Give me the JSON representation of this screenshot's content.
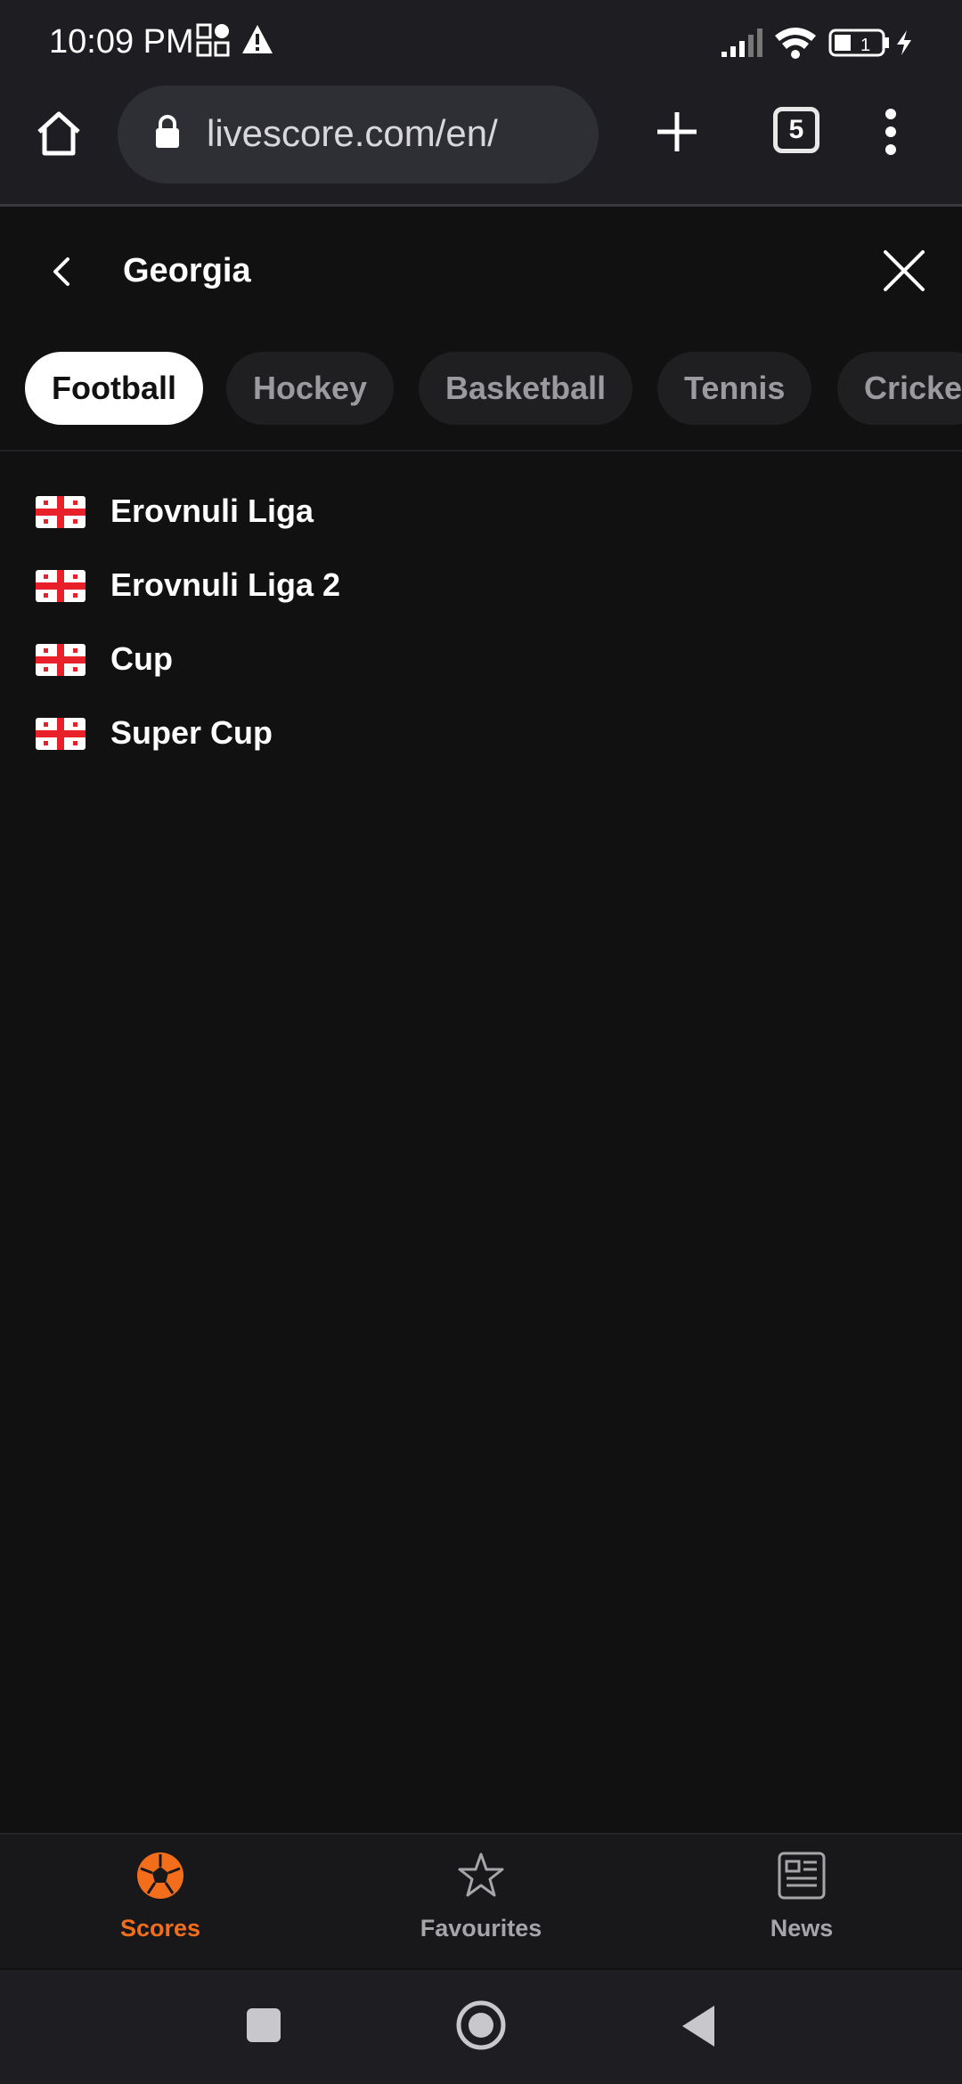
{
  "status": {
    "time": "10:09 PM",
    "battery": "1"
  },
  "browser": {
    "url": "livescore.com/en/",
    "tab_count": "5"
  },
  "header": {
    "title": "Georgia"
  },
  "tabs": [
    {
      "label": "Football",
      "active": true
    },
    {
      "label": "Hockey",
      "active": false
    },
    {
      "label": "Basketball",
      "active": false
    },
    {
      "label": "Tennis",
      "active": false
    },
    {
      "label": "Cricke",
      "active": false
    }
  ],
  "competitions": [
    {
      "label": "Erovnuli Liga",
      "icon": "georgia-flag-icon"
    },
    {
      "label": "Erovnuli Liga 2",
      "icon": "georgia-flag-icon"
    },
    {
      "label": "Cup",
      "icon": "georgia-flag-icon"
    },
    {
      "label": "Super Cup",
      "icon": "georgia-flag-icon"
    }
  ],
  "bottom_nav": [
    {
      "label": "Scores",
      "icon": "soccer-ball-icon",
      "active": true
    },
    {
      "label": "Favourites",
      "icon": "star-icon",
      "active": false
    },
    {
      "label": "News",
      "icon": "news-icon",
      "active": false
    }
  ],
  "colors": {
    "accent": "#f36e1b",
    "background": "#111112",
    "flag_red": "#e8202a"
  }
}
